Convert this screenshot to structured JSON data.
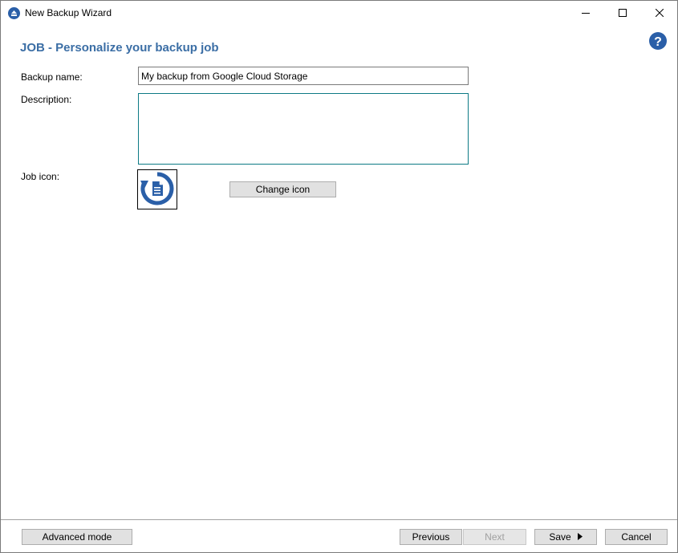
{
  "window": {
    "title": "New Backup Wizard",
    "icon": "backup-app-icon",
    "controls": [
      "minimize-icon",
      "maximize-icon",
      "close-icon"
    ]
  },
  "header": {
    "title": "JOB - Personalize your backup job",
    "help_icon": "help-question-icon",
    "title_color": "#3b6ea5"
  },
  "form": {
    "backup_name_label": "Backup name:",
    "backup_name_value": "My backup from Google Cloud Storage",
    "description_label": "Description:",
    "description_value": "",
    "job_icon_label": "Job icon:",
    "job_icon": "backup-restore-document-icon",
    "change_icon_button": "Change icon"
  },
  "footer": {
    "advanced_mode": "Advanced mode",
    "previous": "Previous",
    "next": "Next",
    "save": "Save",
    "cancel": "Cancel"
  },
  "colors": {
    "accent": "#3b6ea5",
    "focus_border": "#0d7a85",
    "button_bg": "#e1e1e1"
  }
}
